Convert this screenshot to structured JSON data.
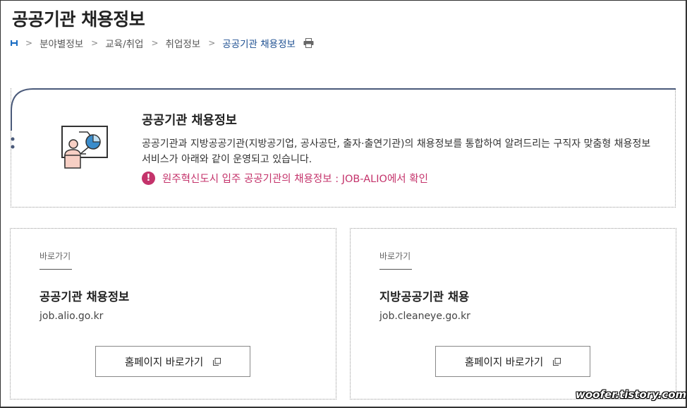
{
  "page": {
    "title": "공공기관 채용정보"
  },
  "breadcrumb": {
    "home_icon": "home-icon",
    "items": [
      "분야별정보",
      "교육/취업",
      "취업정보"
    ],
    "current": "공공기관 채용정보",
    "print_icon": "print-icon"
  },
  "intro": {
    "title": "공공기관 채용정보",
    "description": "공공기관과 지방공공기관(지방공기업, 공사공단, 출자·출연기관)의 채용정보를 통합하여 알려드리는 구직자 맞춤형 채용정보서비스가 아래와 같이 운영되고 있습니다.",
    "notice": "원주혁신도시 입주 공공기관의 채용정보 : JOB-ALIO에서 확인",
    "notice_color": "#c4336b"
  },
  "cards": [
    {
      "tag": "바로가기",
      "title": "공공기관 채용정보",
      "url": "job.alio.go.kr",
      "button": "홈페이지 바로가기"
    },
    {
      "tag": "바로가기",
      "title": "지방공공기관 채용",
      "url": "job.cleaneye.go.kr",
      "button": "홈페이지 바로가기"
    }
  ],
  "watermark": "woofer.tistory.com",
  "colors": {
    "accent": "#1d4f91",
    "curve": "#4a5a7a"
  }
}
